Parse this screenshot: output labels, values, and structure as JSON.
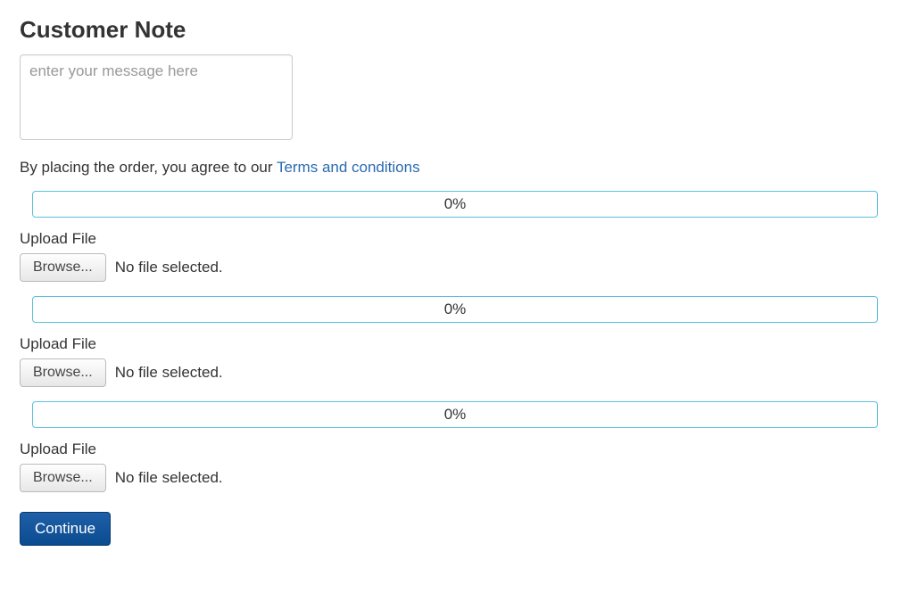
{
  "heading": "Customer Note",
  "note": {
    "placeholder": "enter your message here",
    "value": ""
  },
  "agreement": {
    "prefix": "By placing the order, you agree to our ",
    "link_text": "Terms and conditions"
  },
  "uploads": [
    {
      "progress_text": "0%",
      "label": "Upload File",
      "browse_label": "Browse...",
      "status": "No file selected."
    },
    {
      "progress_text": "0%",
      "label": "Upload File",
      "browse_label": "Browse...",
      "status": "No file selected."
    },
    {
      "progress_text": "0%",
      "label": "Upload File",
      "browse_label": "Browse...",
      "status": "No file selected."
    }
  ],
  "continue_label": "Continue"
}
